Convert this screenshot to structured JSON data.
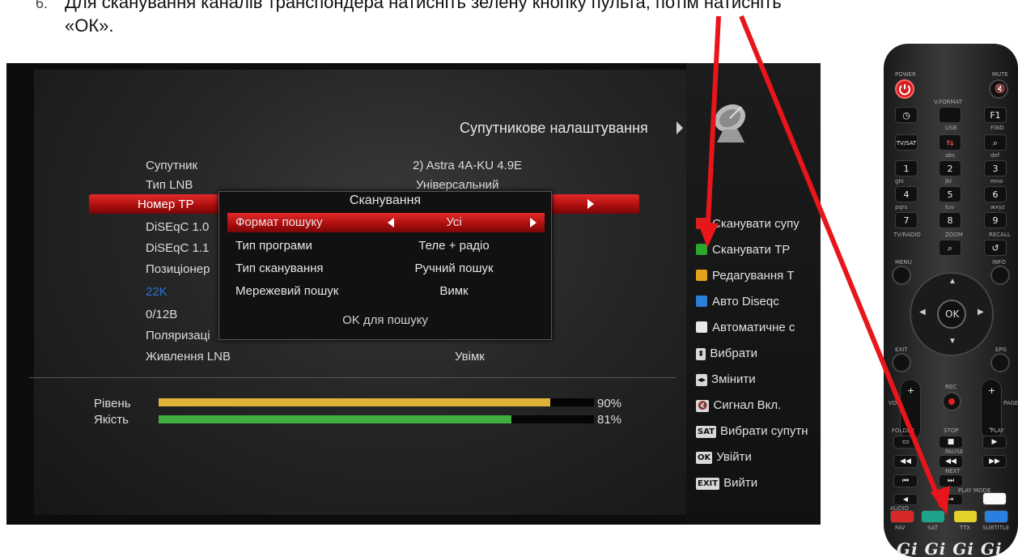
{
  "instruction": {
    "number": "6.",
    "line1": "Для сканування каналів транспондера натисніть зелену кнопку пульта, потім натисніть",
    "line2": "«ОК»."
  },
  "screen": {
    "header": "Супутникове налаштування",
    "rows": [
      {
        "label": "Супутник",
        "value": "2) Astra 4A-KU 4.9E"
      },
      {
        "label": "Тип LNB",
        "value": "Універсальний"
      },
      {
        "label": "Номер ТР",
        "value": ""
      },
      {
        "label": "DiSEqC 1.0",
        "value": ""
      },
      {
        "label": "DiSEqC 1.1",
        "value": ""
      },
      {
        "label": "Позиціонер",
        "value": ""
      },
      {
        "label": "22K",
        "value": ""
      },
      {
        "label": "0/12B",
        "value": ""
      },
      {
        "label": "Поляризаці",
        "value": ""
      },
      {
        "label": "Живлення LNB",
        "value": "Увімк"
      }
    ],
    "dialog": {
      "title": "Сканування",
      "rows": [
        {
          "label": "Формат пошуку",
          "value": "Усі"
        },
        {
          "label": "Тип програми",
          "value": "Теле + радіо"
        },
        {
          "label": "Тип сканування",
          "value": "Ручний пошук"
        },
        {
          "label": "Мережевий пошук",
          "value": "Вимк"
        }
      ],
      "ok": "OK для пошуку"
    },
    "meters": [
      {
        "label": "Рівень",
        "percent": 90,
        "text": "90%",
        "color": "#e0b23a"
      },
      {
        "label": "Якість",
        "percent": 81,
        "text": "81%",
        "color": "#3fae3f"
      }
    ],
    "legend": [
      {
        "type": "color",
        "color": "#d82020",
        "label": "Сканувати супу"
      },
      {
        "type": "color",
        "color": "#2aa62a",
        "label": "Сканувати ТР"
      },
      {
        "type": "color",
        "color": "#e3a21c",
        "label": "Редагування Т"
      },
      {
        "type": "color",
        "color": "#2a7fd6",
        "label": "Авто Diseqc"
      },
      {
        "type": "color",
        "color": "#e8e8e8",
        "label": "Автоматичне с"
      },
      {
        "type": "icon",
        "icon": "up-down-icon",
        "key": "⬍",
        "label": "Вибрати"
      },
      {
        "type": "icon",
        "icon": "left-right-icon",
        "key": "◂▸",
        "label": "Змінити"
      },
      {
        "type": "icon",
        "icon": "mute-icon",
        "key": "🔇",
        "label": "Сигнал Вкл."
      },
      {
        "type": "key",
        "key": "SAT",
        "label": "Вибрати супутн"
      },
      {
        "type": "key",
        "key": "OK",
        "label": "Увійти"
      },
      {
        "type": "key",
        "key": "EXIT",
        "label": "Вийти"
      }
    ]
  },
  "remote": {
    "labels": {
      "power": "POWER",
      "mute": "MUTE",
      "vformat": "V.FORMAT",
      "f1": "F1",
      "usb": "USB",
      "find": "FIND",
      "tvsat": "TV/SAT",
      "abc": "abc",
      "def": "def",
      "ghi": "ghi",
      "jkl": "jkl",
      "mno": "mno",
      "pqrs": "pqrs",
      "tuv": "tuv",
      "wxyz": "wxyz",
      "tvradio": "TV/RADIO",
      "zoom": "ZOOM",
      "recall": "RECALL",
      "menu": "MENU",
      "info": "INFO",
      "ok": "OK",
      "exit": "EXIT",
      "epg": "EPG",
      "vol": "VOL",
      "page": "PAGE",
      "rec": "REC",
      "folder": "FOLDER",
      "stop": "STOP",
      "play": "PLAY",
      "pause": "PAUSE",
      "next": "NEXT",
      "playmode": "PLAY MODE",
      "audio": "AUDIO",
      "fav": "FAV",
      "sat": "SAT",
      "ttx": "TTX",
      "subtitle": "SUBTITLE"
    },
    "digits": [
      "1",
      "2",
      "3",
      "4",
      "5",
      "6",
      "7",
      "8",
      "9"
    ],
    "color_keys": [
      "#d82828",
      "#1fa38a",
      "#e4d12a",
      "#2a7fe0"
    ],
    "brand": "Gi Gi Gi Gi Gi"
  }
}
